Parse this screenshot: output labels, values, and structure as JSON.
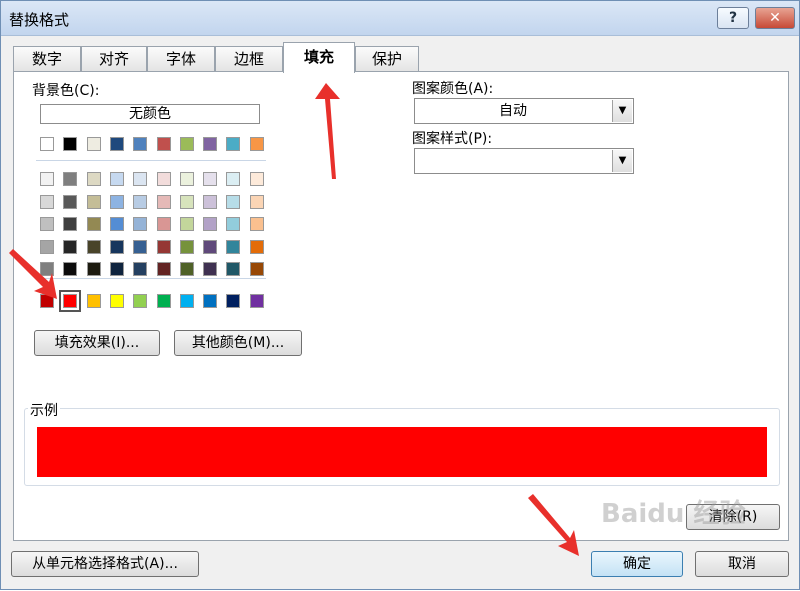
{
  "window": {
    "title": "替换格式",
    "help_label": "?",
    "close_label": "✕"
  },
  "tabs": [
    {
      "label": "数字",
      "active": false
    },
    {
      "label": "对齐",
      "active": false
    },
    {
      "label": "字体",
      "active": false
    },
    {
      "label": "边框",
      "active": false
    },
    {
      "label": "填充",
      "active": true
    },
    {
      "label": "保护",
      "active": false
    }
  ],
  "background": {
    "label": "背景色(C):",
    "no_color_label": "无颜色",
    "theme_top": [
      "#ffffff",
      "#000000",
      "#eeece1",
      "#1f497d",
      "#4f81bd",
      "#c0504d",
      "#9bbb59",
      "#8064a2",
      "#4bacc6",
      "#f79646"
    ],
    "theme_tints": [
      [
        "#f2f2f2",
        "#7f7f7f",
        "#ddd9c3",
        "#c6d9f0",
        "#dbe5f1",
        "#f2dcdb",
        "#ebf1dd",
        "#e5e0ec",
        "#dbeef3",
        "#fdeada"
      ],
      [
        "#d8d8d8",
        "#595959",
        "#c4bd97",
        "#8db3e2",
        "#b8cce4",
        "#e5b9b7",
        "#d7e3bc",
        "#ccc1d9",
        "#b7dde8",
        "#fbd5b5"
      ],
      [
        "#bfbfbf",
        "#3f3f3f",
        "#938953",
        "#548dd4",
        "#95b3d7",
        "#d99694",
        "#c3d69b",
        "#b2a2c7",
        "#92cddc",
        "#fac08f"
      ],
      [
        "#a5a5a5",
        "#262626",
        "#494429",
        "#17365d",
        "#366092",
        "#953734",
        "#76923c",
        "#5f497a",
        "#31859b",
        "#e36c09"
      ],
      [
        "#7f7f7f",
        "#0c0c0c",
        "#1d1b10",
        "#0f243e",
        "#244061",
        "#632423",
        "#4f6128",
        "#3f3151",
        "#205867",
        "#974806"
      ]
    ],
    "standard": [
      "#c00000",
      "#ff0000",
      "#ffc000",
      "#ffff00",
      "#92d050",
      "#00b050",
      "#00b0f0",
      "#0070c0",
      "#002060",
      "#7030a0"
    ],
    "selected_color": "#ff0000",
    "fill_effects_label": "填充效果(I)...",
    "more_colors_label": "其他颜色(M)..."
  },
  "pattern": {
    "color_label": "图案颜色(A):",
    "color_value": "自动",
    "style_label": "图案样式(P):",
    "style_value": ""
  },
  "sample": {
    "label": "示例",
    "color": "#ff0000"
  },
  "buttons": {
    "clear": "清除(R)",
    "choose_from_cell": "从单元格选择格式(A)...",
    "ok": "确定",
    "cancel": "取消"
  },
  "watermark": "Baidu 经验",
  "annotation_color": "#e8302b"
}
